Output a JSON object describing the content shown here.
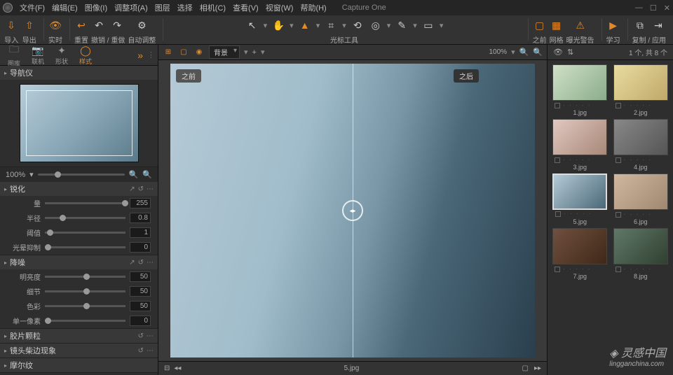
{
  "app": {
    "title": "Capture One"
  },
  "menu": [
    "文件(F)",
    "编辑(E)",
    "图像(I)",
    "调整项(A)",
    "图层",
    "选择",
    "相机(C)",
    "查看(V)",
    "视窗(W)",
    "帮助(H)"
  ],
  "toolbar": {
    "import": "导入",
    "export": "导出",
    "live": "实时",
    "reset": "重置",
    "undoredo": "撤销 / 重做",
    "autoadj": "自动调整",
    "cursor": "光标工具",
    "before": "之前",
    "grid": "网格",
    "expwarn": "曝光警告",
    "learn": "学习",
    "copyapply": "复制 / 应用"
  },
  "tooltabs": {
    "library": "图库",
    "capture": "联机",
    "shape": "形状",
    "style": "样式"
  },
  "nav": {
    "title": "导航仪",
    "zoom": "100%"
  },
  "sharpen": {
    "title": "锐化",
    "amount": {
      "label": "量",
      "value": "255",
      "pos": 100
    },
    "radius": {
      "label": "半径",
      "value": "0.8",
      "pos": 20
    },
    "threshold": {
      "label": "阈值",
      "value": "1",
      "pos": 5
    },
    "halo": {
      "label": "光晕抑制",
      "value": "0",
      "pos": 0
    }
  },
  "noise": {
    "title": "降噪",
    "luminance": {
      "label": "明亮度",
      "value": "50",
      "pos": 50
    },
    "details": {
      "label": "细节",
      "value": "50",
      "pos": 50
    },
    "color": {
      "label": "色彩",
      "value": "50",
      "pos": 50
    },
    "pixel": {
      "label": "单一像素",
      "value": "0",
      "pos": 0
    }
  },
  "film": {
    "title": "胶片颗粒"
  },
  "lens": {
    "title": "镜头柴边现象"
  },
  "moire": {
    "title": "摩尔纹"
  },
  "viewer": {
    "layer": "背景",
    "zoom": "100%",
    "before": "之前",
    "after": "之后",
    "filename": "5.jpg"
  },
  "browser": {
    "count": "1 个, 共 8 个",
    "thumbs": [
      {
        "name": "1.jpg",
        "cls": "g1"
      },
      {
        "name": "2.jpg",
        "cls": "g2"
      },
      {
        "name": "3.jpg",
        "cls": "g3"
      },
      {
        "name": "4.jpg",
        "cls": "g4"
      },
      {
        "name": "5.jpg",
        "cls": "g5",
        "sel": true
      },
      {
        "name": "6.jpg",
        "cls": "g6"
      },
      {
        "name": "7.jpg",
        "cls": "g7"
      },
      {
        "name": "8.jpg",
        "cls": "g8"
      }
    ]
  },
  "watermark": {
    "text": "灵感中国",
    "sub": "lingganchina.com"
  }
}
